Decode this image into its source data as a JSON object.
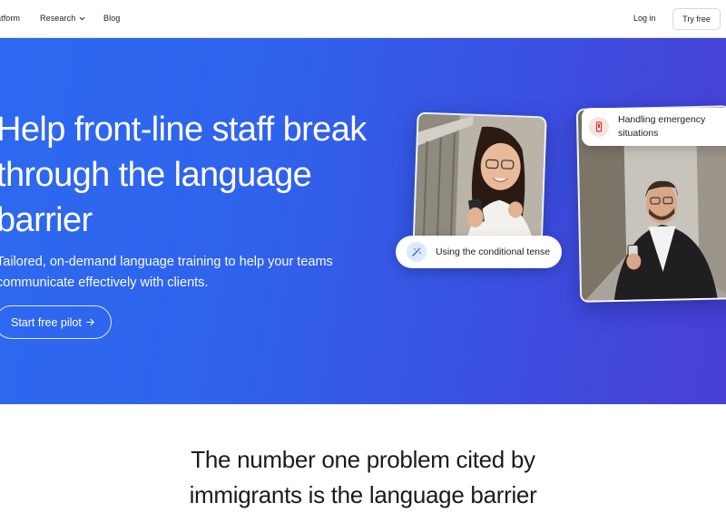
{
  "nav": {
    "platform_label": "atform",
    "research_label": "Research",
    "blog_label": "Blog",
    "login_label": "Log in",
    "try_label": "Try free"
  },
  "hero": {
    "title": "Help front-line staff break through the language barrier",
    "subtitle": "Tailored, on-demand language training to help your teams communicate effectively with clients.",
    "cta_label": "Start free pilot",
    "chip_tense": "Using the conditional tense",
    "chip_emergency": "Handling emergency situations",
    "gradient_start": "#2d69f0",
    "gradient_end": "#4a3fd6"
  },
  "section": {
    "problem_text": "The number one problem cited by immigrants is the language barrier"
  },
  "icons": {
    "research_chevron": "chevron-down-icon",
    "cta_arrow": "arrow-right-icon",
    "tense_icon": "magic-wand-icon",
    "emergency_icon": "emergency-phone-icon"
  }
}
